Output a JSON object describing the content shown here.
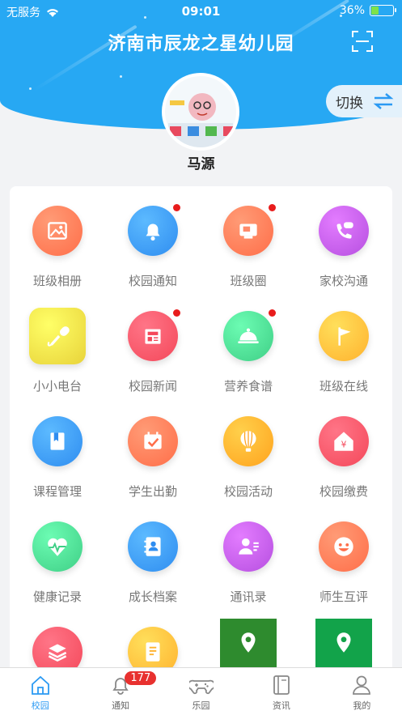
{
  "status": {
    "carrier": "无服务",
    "time": "09:01",
    "battery": "36%",
    "battery_level": 0.36
  },
  "header": {
    "title": "济南市辰龙之星幼儿园",
    "switch_label": "切换"
  },
  "user": {
    "name": "马源"
  },
  "grid": [
    {
      "label": "班级相册",
      "icon": "photo-album-icon",
      "color": "#ff6e49",
      "dot": false
    },
    {
      "label": "校园通知",
      "icon": "bell-icon",
      "color": "#2f8df0",
      "dot": true
    },
    {
      "label": "班级圈",
      "icon": "class-circle-icon",
      "color": "#ff6e49",
      "dot": true
    },
    {
      "label": "家校沟通",
      "icon": "phone-chat-icon",
      "color": "#b64fe0",
      "dot": false
    },
    {
      "label": "小小电台",
      "icon": "microphone-icon",
      "color": "#e8d33a",
      "dot": false
    },
    {
      "label": "校园新闻",
      "icon": "newspaper-icon",
      "color": "#f4485a",
      "dot": true
    },
    {
      "label": "营养食谱",
      "icon": "food-cover-icon",
      "color": "#3fcf86",
      "dot": true
    },
    {
      "label": "班级在线",
      "icon": "flag-icon",
      "color": "#ffb22e",
      "dot": false
    },
    {
      "label": "课程管理",
      "icon": "book-icon",
      "color": "#2f8df0",
      "dot": false
    },
    {
      "label": "学生出勤",
      "icon": "calendar-check-icon",
      "color": "#ff6e49",
      "dot": false
    },
    {
      "label": "校园活动",
      "icon": "hot-air-balloon-icon",
      "color": "#ffa31e",
      "dot": false
    },
    {
      "label": "校园缴费",
      "icon": "house-yuan-icon",
      "color": "#f4485a",
      "dot": false
    },
    {
      "label": "健康记录",
      "icon": "heart-pulse-icon",
      "color": "#3fcf86",
      "dot": false
    },
    {
      "label": "成长档案",
      "icon": "contact-book-icon",
      "color": "#2f8df0",
      "dot": false
    },
    {
      "label": "通讯录",
      "icon": "contacts-icon",
      "color": "#b64fe0",
      "dot": false
    },
    {
      "label": "师生互评",
      "icon": "smile-icon",
      "color": "#ff6e49",
      "dot": false
    },
    {
      "label": "",
      "icon": "layers-icon",
      "color": "#f4485a",
      "dot": false
    },
    {
      "label": "",
      "icon": "document-icon",
      "color": "#ffb22e",
      "dot": false
    },
    {
      "label": "",
      "icon": "location-pin-icon",
      "color": "#2e8b2e",
      "dot": false
    },
    {
      "label": "",
      "icon": "location-pin-icon",
      "color": "#12a34a",
      "dot": false
    }
  ],
  "tabbar": [
    {
      "label": "校园",
      "icon": "home-icon",
      "active": true
    },
    {
      "label": "通知",
      "icon": "bell-icon",
      "badge": "177"
    },
    {
      "label": "乐园",
      "icon": "gamepad-icon"
    },
    {
      "label": "资讯",
      "icon": "news-book-icon"
    },
    {
      "label": "我的",
      "icon": "user-icon"
    }
  ]
}
